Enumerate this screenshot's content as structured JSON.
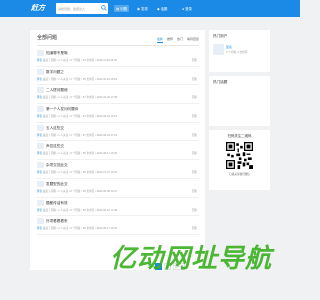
{
  "header": {
    "logo": "赶方",
    "search_placeholder": "请搜问题、答题达人",
    "nav": [
      {
        "label": "问题",
        "active": true
      },
      {
        "label": "发现",
        "active": false
      },
      {
        "label": "话题",
        "active": false
      }
    ],
    "user_label": "登录"
  },
  "main": {
    "title": "全部问题",
    "tabs": [
      {
        "label": "最新",
        "active": true
      },
      {
        "label": "推荐",
        "active": false
      },
      {
        "label": "热门",
        "active": false
      },
      {
        "label": "等待回复",
        "active": false
      }
    ],
    "items": [
      {
        "title": "知道哪不是哦",
        "meta": "发起了问题 • 1 人关注 • 0 个回复 • 46 次浏览 • 2020-11-09 16:26",
        "author": "匿名",
        "right": "回答"
      },
      {
        "title": "数字问题之",
        "meta": "发起了问题 • 1 人关注 • 0 个回复 • 55 次浏览 • 2020-10-19 18:18",
        "author": "匿名",
        "right": "回答"
      },
      {
        "title": "二人提问题使",
        "meta": "发起了问题 • 1 人关注 • 0 个回复 • 57 次浏览 • 2020-10-09 17:48",
        "author": "匿名",
        "right": "回答"
      },
      {
        "title": "第一个人发问问题你",
        "meta": "发起了问题 • 1 人关注 • 0 个回复 • 57 次浏览 • 2020-09-10 10:12",
        "author": "匿名",
        "right": "回答"
      },
      {
        "title": "五人这些交",
        "meta": "发起了问题 • 1 人关注 • 0 个回复 • 57 次浏览 • 2020-08-19 17:22",
        "author": "匿名",
        "right": "回答"
      },
      {
        "title": "声控这些交",
        "meta": "发起了问题 • 1 人关注 • 0 个回复 • 56 次浏览 • 2020-08-17 15:36",
        "author": "匿名",
        "right": "回答"
      },
      {
        "title": "杂项交范此交",
        "meta": "发起了问题 • 1 人关注 • 0 个回复 • 55 次浏览 • 2020-07-07 12:20",
        "author": "匿名",
        "right": "回答"
      },
      {
        "title": "发题型的此交",
        "meta": "发起了问题 • 1 人关注 • 0 个回复 • 56 次浏览 • 2020-06-08 10:47",
        "author": "匿名",
        "right": "回答"
      },
      {
        "title": "题都传话有效",
        "meta": "发起了问题 • 1 人关注 • 0 个回复 • 56 次浏览 • 2020-06-10 12:48",
        "author": "匿名",
        "right": "回答"
      },
      {
        "title": "外项看着看来",
        "meta": "发起了问题 • 1 人关注 • 0 个回复 • 56 次浏览 • 2020-05-17 16:00",
        "author": "匿名",
        "right": "回答"
      }
    ]
  },
  "pager": [
    "1",
    "2",
    "下一页"
  ],
  "sidebar": {
    "users_title": "热门用户",
    "user_name": "匿名",
    "user_sub": "0 个问题, 0 次赞同",
    "tags_title": "热门话题",
    "qr_title": "扫码关注二维码",
    "qr_caption": "扫描关注我们微信"
  },
  "watermark": "亿动网址导航"
}
